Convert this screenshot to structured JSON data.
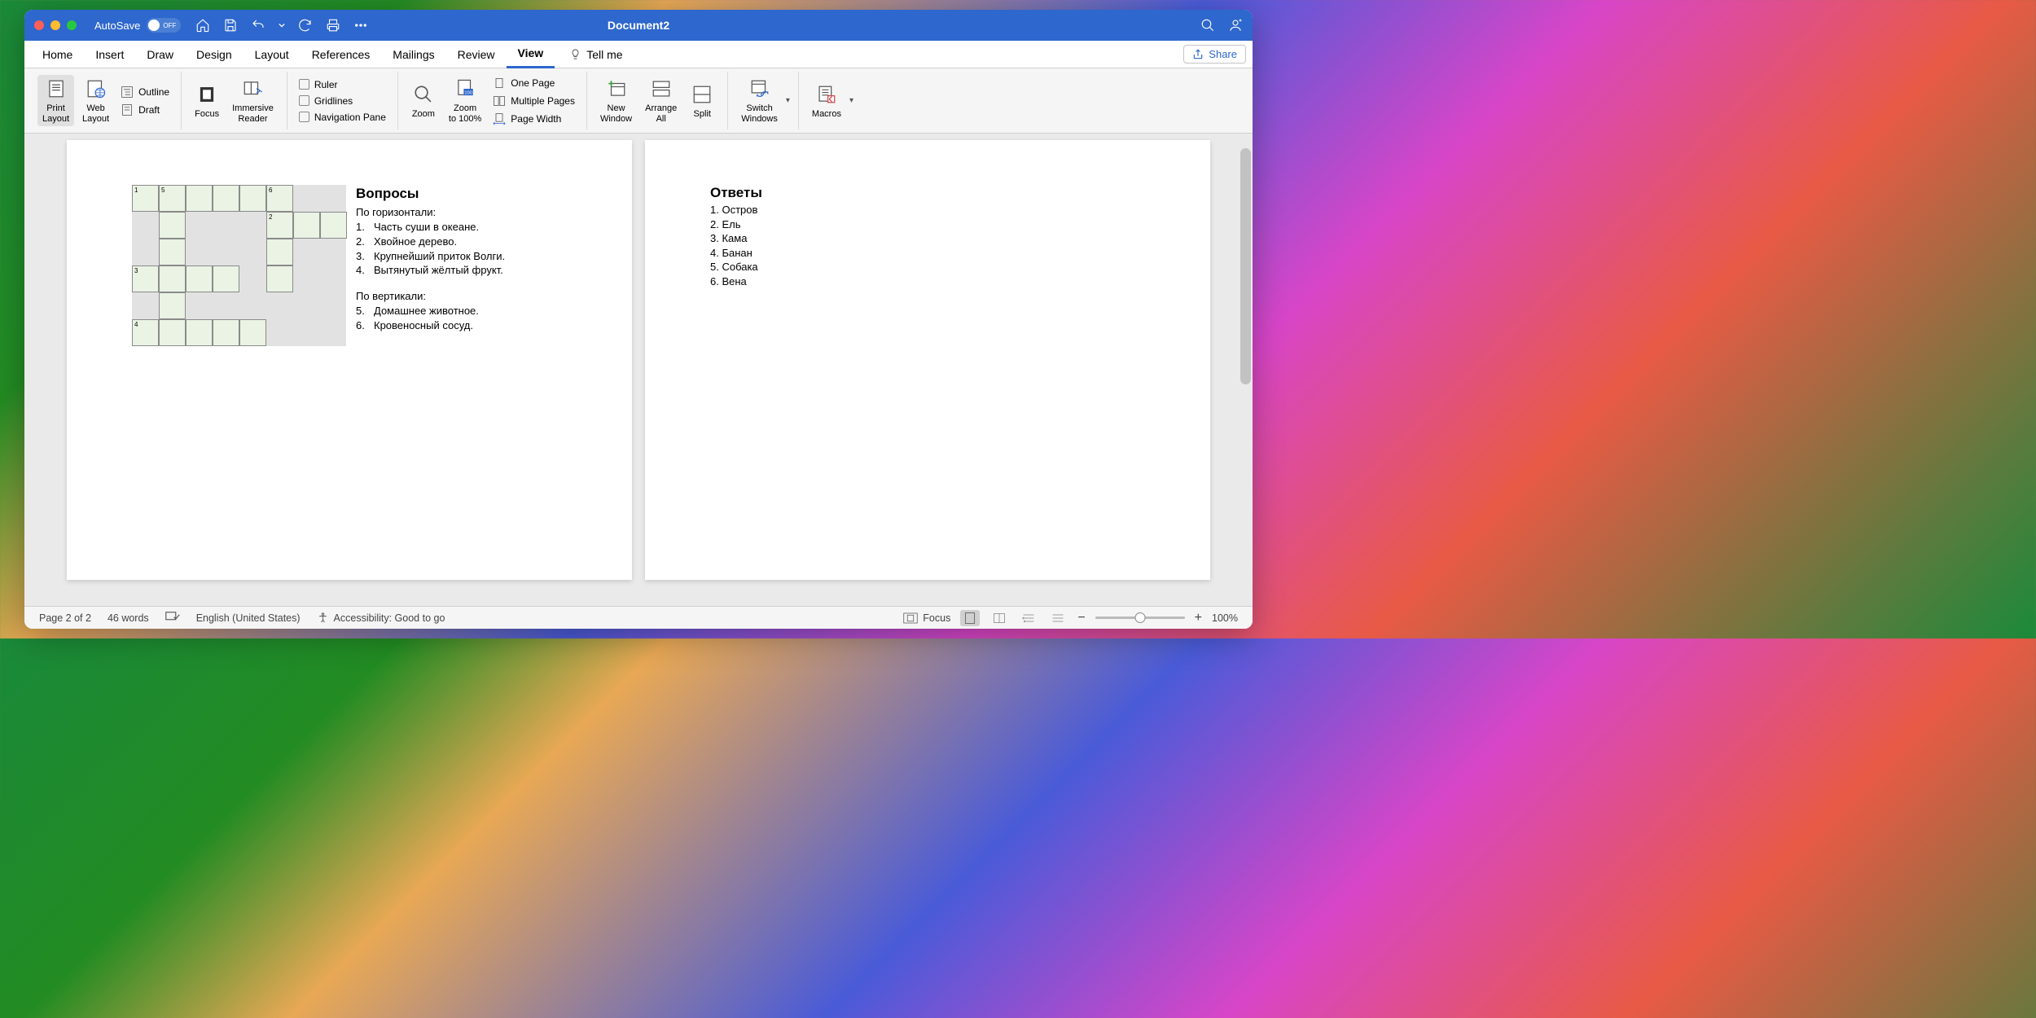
{
  "titlebar": {
    "autosave_label": "AutoSave",
    "autosave_state": "OFF",
    "doc_title": "Document2"
  },
  "tabs": [
    "Home",
    "Insert",
    "Draw",
    "Design",
    "Layout",
    "References",
    "Mailings",
    "Review",
    "View"
  ],
  "active_tab": "View",
  "tellme": "Tell me",
  "share": "Share",
  "ribbon": {
    "print_layout": "Print\nLayout",
    "web_layout": "Web\nLayout",
    "outline": "Outline",
    "draft": "Draft",
    "focus": "Focus",
    "immersive": "Immersive\nReader",
    "ruler": "Ruler",
    "gridlines": "Gridlines",
    "navpane": "Navigation Pane",
    "zoom": "Zoom",
    "zoom100": "Zoom\nto 100%",
    "onepage": "One Page",
    "multipages": "Multiple Pages",
    "pagewidth": "Page Width",
    "newwindow": "New\nWindow",
    "arrangeall": "Arrange\nAll",
    "split": "Split",
    "switchwin": "Switch\nWindows",
    "macros": "Macros"
  },
  "page_left": {
    "title": "Вопросы",
    "across_head": "По горизонтали:",
    "across": [
      "Часть суши в океане.",
      "Хвойное дерево.",
      "Крупнейший приток Волги.",
      "Вытянутый жёлтый фрукт."
    ],
    "down_head": "По вертикали:",
    "down": [
      "Домашнее животное.",
      "Кровеносный сосуд."
    ],
    "down_start": 5,
    "crossword_cells": [
      {
        "r": 0,
        "c": 0,
        "n": "1"
      },
      {
        "r": 0,
        "c": 1,
        "n": "5"
      },
      {
        "r": 0,
        "c": 2
      },
      {
        "r": 0,
        "c": 3
      },
      {
        "r": 0,
        "c": 4
      },
      {
        "r": 0,
        "c": 5,
        "n": "6"
      },
      {
        "r": 1,
        "c": 1
      },
      {
        "r": 1,
        "c": 5,
        "n": "2"
      },
      {
        "r": 1,
        "c": 6
      },
      {
        "r": 1,
        "c": 7
      },
      {
        "r": 2,
        "c": 1
      },
      {
        "r": 2,
        "c": 5
      },
      {
        "r": 3,
        "c": 0,
        "n": "3"
      },
      {
        "r": 3,
        "c": 1
      },
      {
        "r": 3,
        "c": 2
      },
      {
        "r": 3,
        "c": 3
      },
      {
        "r": 3,
        "c": 5
      },
      {
        "r": 4,
        "c": 1
      },
      {
        "r": 5,
        "c": 0,
        "n": "4"
      },
      {
        "r": 5,
        "c": 1
      },
      {
        "r": 5,
        "c": 2
      },
      {
        "r": 5,
        "c": 3
      },
      {
        "r": 5,
        "c": 4
      }
    ]
  },
  "page_right": {
    "title": "Ответы",
    "answers": [
      "Остров",
      "Ель",
      "Кама",
      "Банан",
      "Собака",
      "Вена"
    ]
  },
  "statusbar": {
    "page": "Page 2 of 2",
    "words": "46 words",
    "lang": "English (United States)",
    "access": "Accessibility: Good to go",
    "focus": "Focus",
    "zoom": "100%"
  }
}
